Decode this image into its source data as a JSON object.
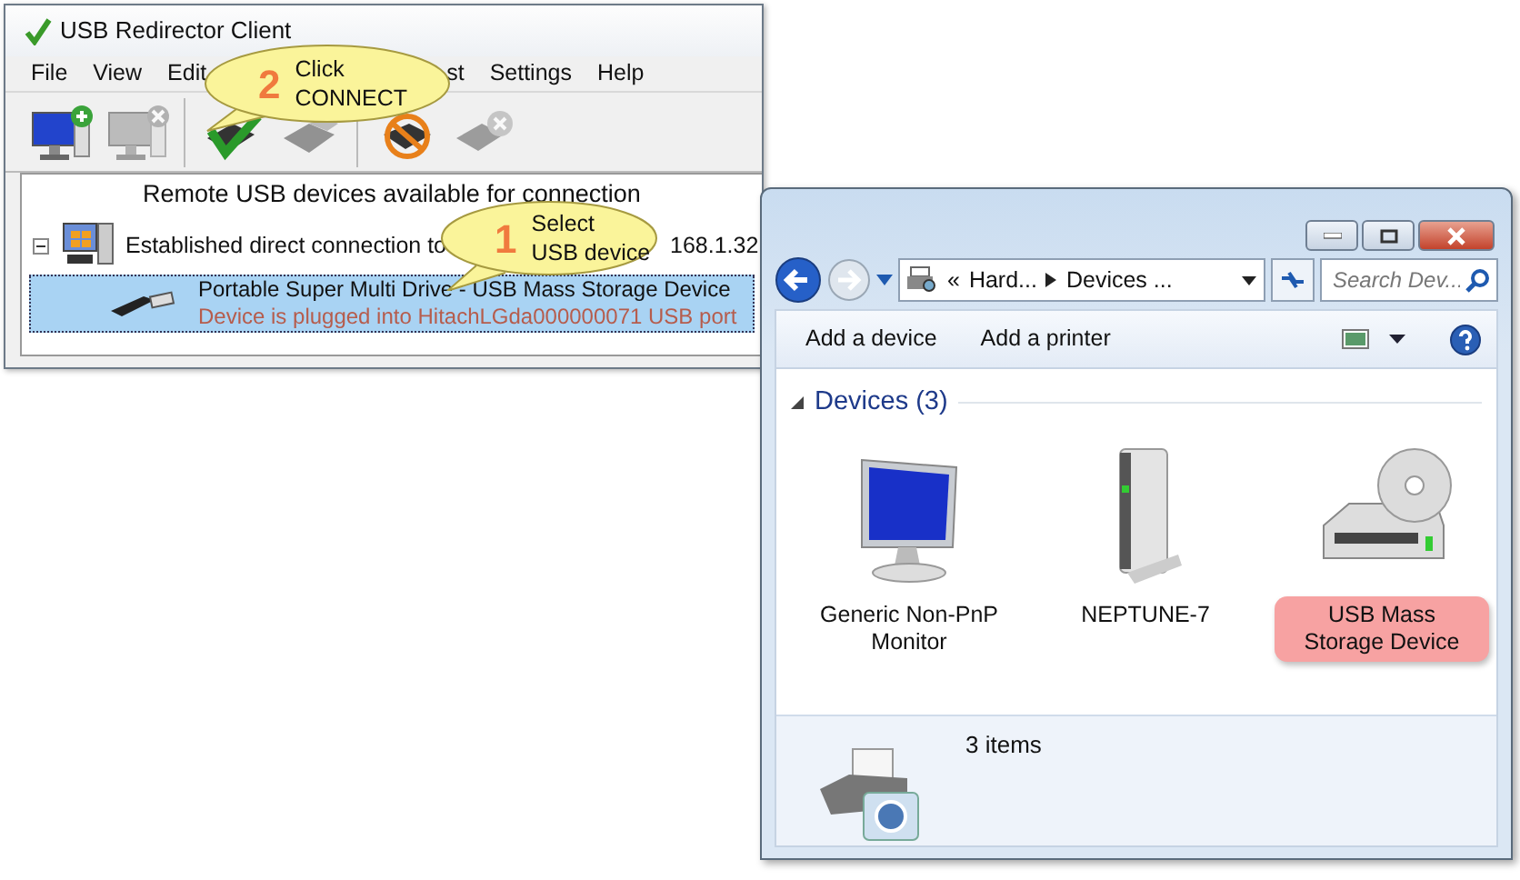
{
  "client_window": {
    "title": "USB Redirector Client",
    "menu": [
      {
        "label": "File"
      },
      {
        "label": "View"
      },
      {
        "label": "Edit"
      },
      {
        "label": "st"
      },
      {
        "label": "Settings"
      },
      {
        "label": "Help"
      }
    ],
    "toolbar": [
      {
        "kind": "add-server",
        "disabled": false
      },
      {
        "kind": "remove-server",
        "disabled": true
      },
      {
        "kind": "connect",
        "disabled": false
      },
      {
        "kind": "disconnect",
        "disabled": true
      },
      {
        "kind": "forbid",
        "disabled": false
      },
      {
        "kind": "remove-device",
        "disabled": true
      }
    ],
    "tree": {
      "header": "Remote USB devices available for connection",
      "servers": [
        {
          "label": "Established direct connection to",
          "address_fragment": "168.1.32",
          "expanded": true,
          "children": [
            {
              "name": "Portable Super Multi Drive - USB Mass Storage Device",
              "status": "Device is plugged into HitachLGda000000071 USB port",
              "selected": true
            }
          ]
        }
      ]
    }
  },
  "callouts": [
    {
      "number": "2",
      "lines": [
        "Click",
        "CONNECT"
      ]
    },
    {
      "number": "1",
      "lines": [
        "Select",
        "USB device"
      ]
    }
  ],
  "explorer_window": {
    "breadcrumb": {
      "overflow": "«",
      "parts": [
        "Hard...",
        "Devices ..."
      ]
    },
    "search": {
      "placeholder": "Search Dev..."
    },
    "commands": [
      "Add a device",
      "Add a printer"
    ],
    "group": {
      "title": "Devices (3)",
      "expanded": true
    },
    "devices": [
      {
        "label": "Generic Non-PnP Monitor",
        "kind": "monitor",
        "selected": false
      },
      {
        "label": "NEPTUNE-7",
        "kind": "server",
        "selected": false
      },
      {
        "label": "USB Mass Storage Device",
        "kind": "drive",
        "selected": true
      }
    ],
    "details": {
      "count": "3 items"
    }
  }
}
